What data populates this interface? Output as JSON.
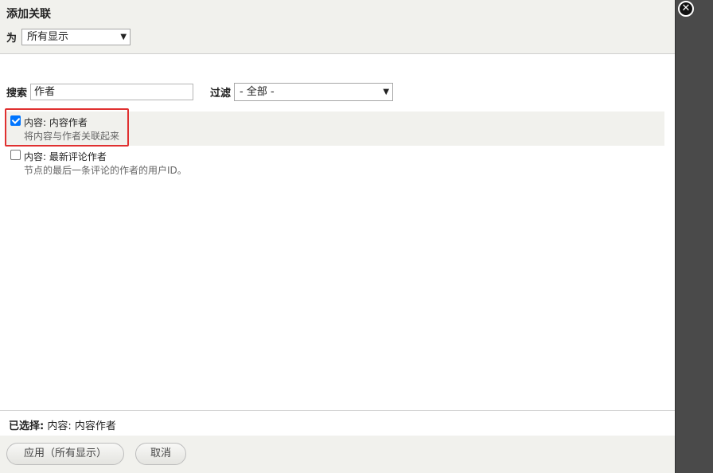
{
  "dialog": {
    "title": "添加关联",
    "for_label": "为",
    "for_value": "所有显示"
  },
  "search": {
    "label": "搜索",
    "value": "作者",
    "filter_label": "过滤",
    "filter_value": "- 全部 -"
  },
  "options": [
    {
      "title": "内容: 内容作者",
      "description": "将内容与作者关联起来",
      "checked": true
    },
    {
      "title": "内容: 最新评论作者",
      "description": "节点的最后一条评论的作者的用户ID。",
      "checked": false
    }
  ],
  "selected": {
    "label": "已选择:",
    "value": "内容: 内容作者"
  },
  "buttons": {
    "apply": "应用（所有显示）",
    "cancel": "取消"
  },
  "icons": {
    "close": "close-icon",
    "dropdown": "chevron-down-icon"
  },
  "colors": {
    "highlight": "#e03030",
    "header_bg": "#f1f1ed",
    "checkbox": "#0075ff"
  }
}
